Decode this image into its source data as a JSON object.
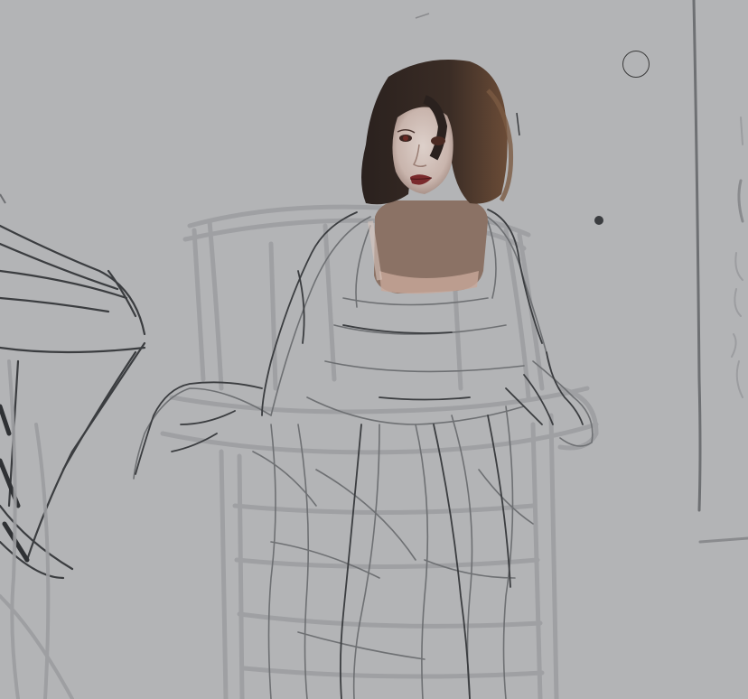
{
  "canvas": {
    "background_color": "#b3b4b6",
    "tool": "brush",
    "cursor_icon": "brush-circle-cursor"
  },
  "palette": {
    "light_sketch": "#9c9da0",
    "mid_sketch": "#6e7073",
    "dark_sketch": "#3b3d40",
    "hair_dark": "#2a2220",
    "hair_brown": "#5a4334",
    "skin_light": "#d4c3bc",
    "skin_shadow": "#a88c82",
    "neck_block": "#8b7265",
    "lips": "#7a2a2c"
  }
}
